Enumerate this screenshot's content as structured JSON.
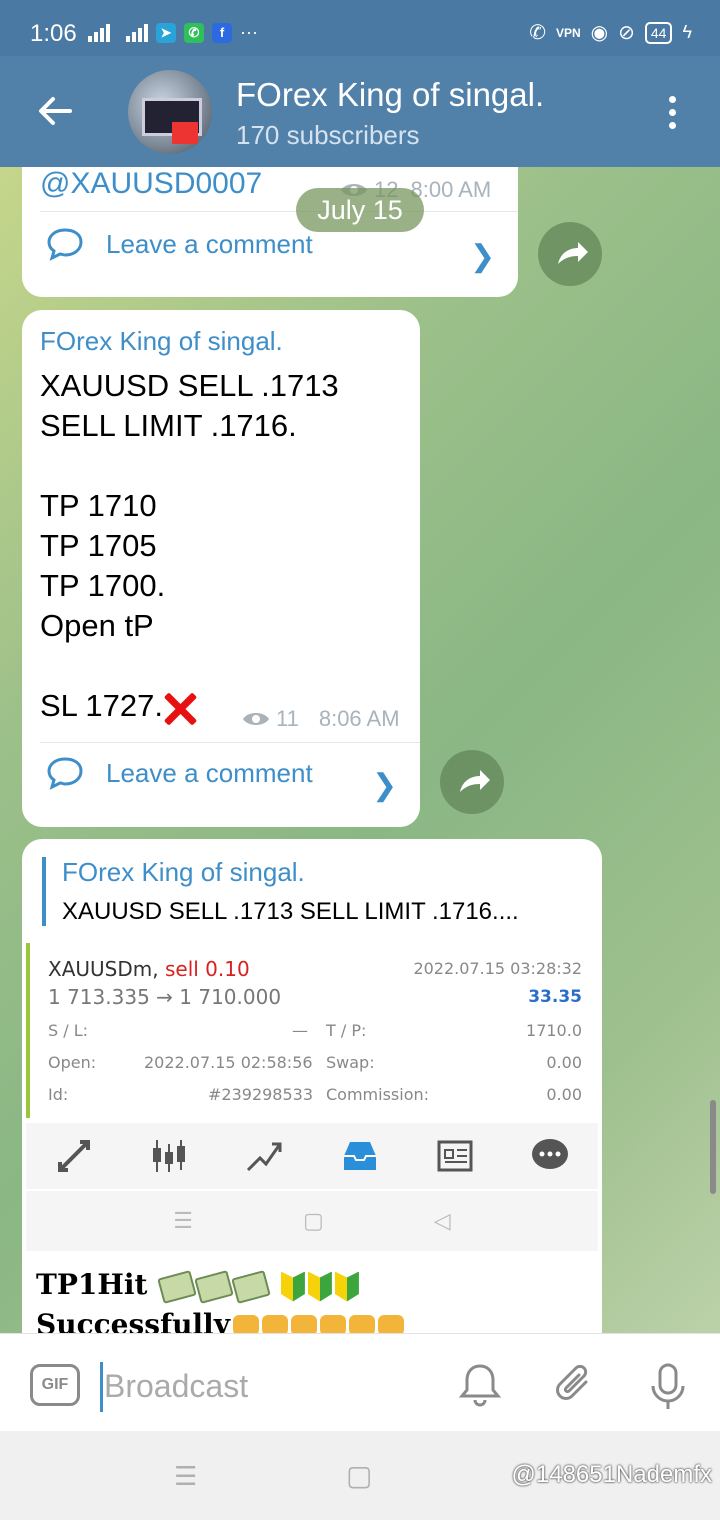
{
  "status_bar": {
    "time": "1:06",
    "battery": "44",
    "app_icons": [
      "telegram-icon",
      "whatsapp-icon",
      "facebook-icon"
    ],
    "more": "···"
  },
  "header": {
    "title": "FOrex King of singal.",
    "subtitle": "170 subscribers"
  },
  "chat": {
    "date_pill": "July 15",
    "messages": [
      {
        "mention": "@XAUUSD0007",
        "views": "12",
        "time": "8:00 AM",
        "comment_label": "Leave a comment"
      },
      {
        "sender": "FOrex King of singal.",
        "lines": [
          "XAUUSD SELL .1713",
          "SELL LIMIT .1716.",
          "",
          "TP 1710",
          "TP 1705",
          "TP 1700.",
          "Open tP",
          "",
          "SL 1727."
        ],
        "views": "11",
        "time": "8:06 AM",
        "comment_label": "Leave a comment"
      },
      {
        "reply_sender": "FOrex King of singal.",
        "reply_text": "XAUUSD SELL .1713 SELL LIMIT .1716....",
        "trade": {
          "symbol": "XAUUSDm,",
          "side": "sell 0.10",
          "datetime": "2022.07.15 03:28:32",
          "price": "1 713.335 → 1 710.000",
          "profit": "33.35",
          "sl_label": "S / L:",
          "sl_value": "—",
          "tp_label": "T / P:",
          "tp_value": "1710.0",
          "open_label": "Open:",
          "open_value": "2022.07.15 02:58:56",
          "swap_label": "Swap:",
          "swap_value": "0.00",
          "id_label": "Id:",
          "id_value": "#239298533",
          "commission_label": "Commission:",
          "commission_value": "0.00"
        },
        "caption_line1": "TP1Hit",
        "caption_line2": "Successfully"
      }
    ]
  },
  "input_bar": {
    "gif_label": "GIF",
    "placeholder": "Broadcast"
  },
  "watermark": "@148651Nademfx",
  "colors": {
    "header": "#5181a9",
    "statusbar": "#4a7aa3",
    "accent": "#3d8ec9",
    "chart_bar": "#9ac73a"
  }
}
